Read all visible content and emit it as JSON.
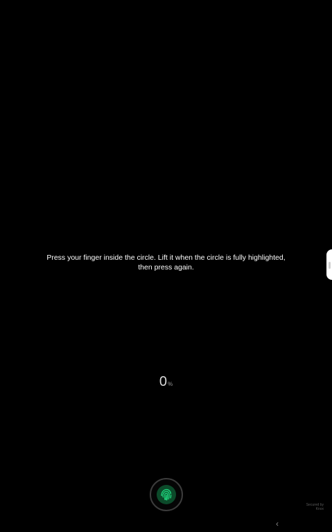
{
  "instruction": {
    "text": "Press your finger inside the circle. Lift it when the circle is fully highlighted, then press again."
  },
  "progress": {
    "value": "0",
    "unit": "%"
  },
  "fingerprint": {
    "icon": "fingerprint-icon",
    "accent": "#1ed07a"
  },
  "footer": {
    "secured_by": "Secured by",
    "brand": "Knox"
  },
  "navigation": {
    "back_icon": "chevron-left-icon",
    "back_glyph": "‹"
  },
  "side_panel": {
    "icon": "edge-panel-handle-icon"
  }
}
